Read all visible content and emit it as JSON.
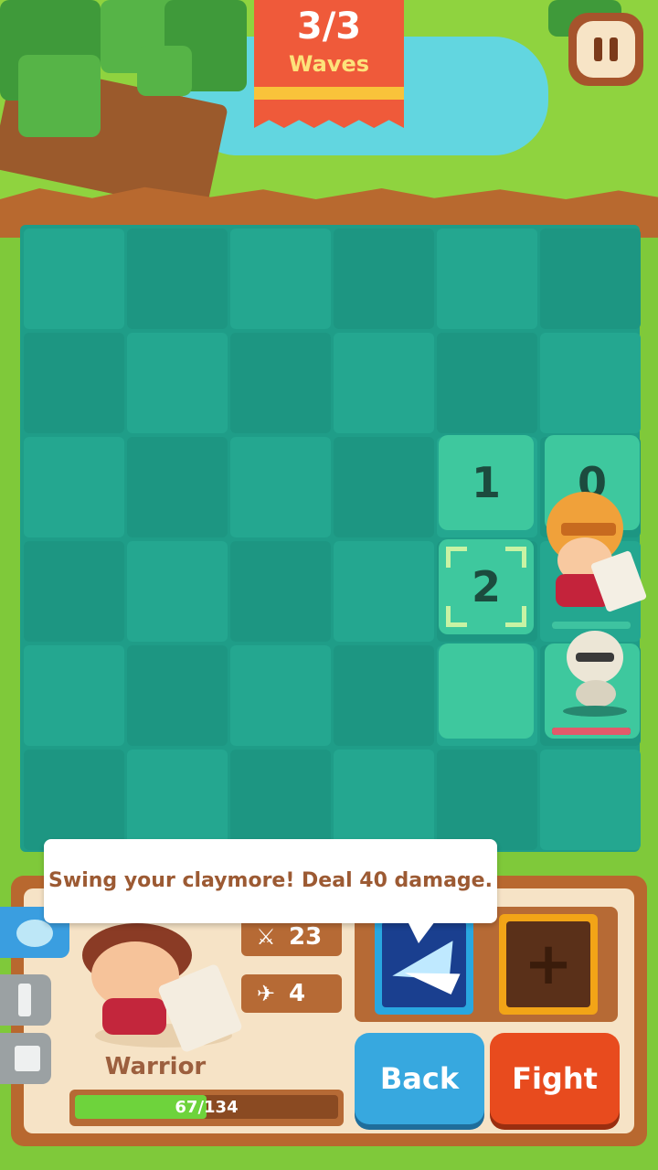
{
  "wave": {
    "count": "3/3",
    "label": "Waves"
  },
  "board": {
    "tiles": [
      {
        "label": "1"
      },
      {
        "label": "0"
      },
      {
        "label": "2"
      },
      {
        "label": ""
      }
    ]
  },
  "tooltip": {
    "text": "Swing your claymore! Deal 40 damage."
  },
  "hero": {
    "name": "Warrior",
    "attack": "23",
    "moves": "4",
    "hp_text": "67/134",
    "hp_fraction": 0.5
  },
  "buttons": {
    "back": "Back",
    "fight": "Fight"
  },
  "empty_slot_symbol": "+",
  "colors": {
    "fight": "#e84b1e",
    "back": "#37a8df",
    "board": "#1f9d88",
    "banner": "#ef5a3a"
  },
  "icons": [
    "pause-icon",
    "sword-icon",
    "winged-boot-icon",
    "spell-tab-icon",
    "tower-tab-icon",
    "castle-tab-icon"
  ]
}
